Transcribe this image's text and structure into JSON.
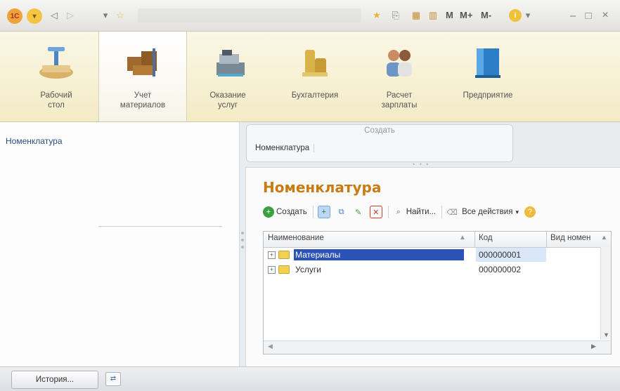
{
  "titlebar": {
    "logo_label": "1С",
    "m_label": "M",
    "mplus_label": "M+",
    "mminus_label": "M-",
    "info_icon": "info-icon",
    "minimize": "–",
    "maximize": "□",
    "close": "×"
  },
  "sections": [
    {
      "label": "Рабочий\nстол",
      "icon": "desk-icon"
    },
    {
      "label": "Учет\nматериалов",
      "icon": "boxes-icon"
    },
    {
      "label": "Оказание\nуслуг",
      "icon": "cash-register-icon"
    },
    {
      "label": "Бухгалтерия",
      "icon": "coins-icon"
    },
    {
      "label": "Расчет\nзарплаты",
      "icon": "people-icon"
    },
    {
      "label": "Предприятие",
      "icon": "building-icon"
    }
  ],
  "left_panel": {
    "link": "Номенклатура"
  },
  "create_panel": {
    "title": "Создать",
    "item": "Номенклатура"
  },
  "form": {
    "title": "Номенклатура",
    "cmd_create": "Создать",
    "cmd_find": "Найти...",
    "cmd_all_actions": "Все действия",
    "columns": [
      "Наименование",
      "Код",
      "Вид номен"
    ],
    "rows": [
      {
        "name": "Материалы",
        "code": "000000001",
        "selected": true
      },
      {
        "name": "Услуги",
        "code": "000000002",
        "selected": false
      }
    ]
  },
  "footer": {
    "history": "История..."
  },
  "colors": {
    "accent_title": "#c77b12",
    "selection": "#2b53b7",
    "ribbon": "#f3ebc6"
  }
}
